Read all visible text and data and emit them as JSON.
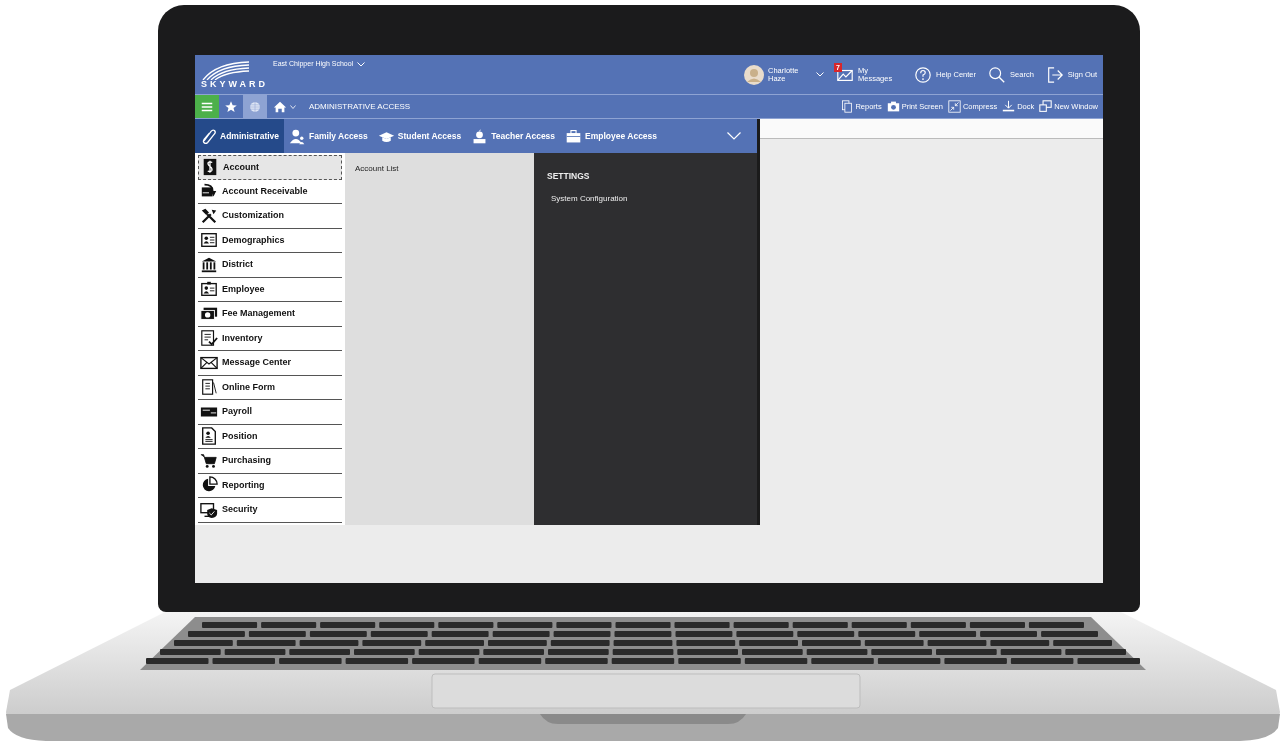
{
  "header": {
    "logo": "SKYWARD",
    "school": "East Chipper High School",
    "user": {
      "name": "Charlotte Haze"
    },
    "actions": [
      {
        "kind": "messages",
        "label": "My Messages",
        "badge": "7"
      },
      {
        "kind": "help",
        "label": "Help Center"
      },
      {
        "kind": "search",
        "label": "Search"
      },
      {
        "kind": "signout",
        "label": "Sign Out"
      }
    ]
  },
  "toolbar": {
    "buttons": [
      {
        "kind": "menu"
      },
      {
        "kind": "star"
      },
      {
        "kind": "globe"
      },
      {
        "kind": "home"
      }
    ],
    "breadcrumb": "ADMINISTRATIVE ACCESS",
    "tools": [
      {
        "kind": "reports",
        "label": "Reports"
      },
      {
        "kind": "print",
        "label": "Print Screen"
      },
      {
        "kind": "compress",
        "label": "Compress"
      },
      {
        "kind": "dock",
        "label": "Dock"
      },
      {
        "kind": "window",
        "label": "New Window"
      }
    ]
  },
  "tabs": [
    {
      "label": "Administrative",
      "selected": true
    },
    {
      "label": "Family Access",
      "selected": false
    },
    {
      "label": "Student Access",
      "selected": false
    },
    {
      "label": "Teacher Access",
      "selected": false
    },
    {
      "label": "Employee Access",
      "selected": false
    }
  ],
  "sidebar": {
    "items": [
      {
        "label": "Account",
        "selected": true
      },
      {
        "label": "Account Receivable",
        "selected": false
      },
      {
        "label": "Customization",
        "selected": false
      },
      {
        "label": "Demographics",
        "selected": false
      },
      {
        "label": "District",
        "selected": false
      },
      {
        "label": "Employee",
        "selected": false
      },
      {
        "label": "Fee Management",
        "selected": false
      },
      {
        "label": "Inventory",
        "selected": false
      },
      {
        "label": "Message Center",
        "selected": false
      },
      {
        "label": "Online Form",
        "selected": false
      },
      {
        "label": "Payroll",
        "selected": false
      },
      {
        "label": "Position",
        "selected": false
      },
      {
        "label": "Purchasing",
        "selected": false
      },
      {
        "label": "Reporting",
        "selected": false
      },
      {
        "label": "Security",
        "selected": false
      }
    ]
  },
  "submenu": {
    "items": [
      "Account List"
    ]
  },
  "settings": {
    "heading": "SETTINGS",
    "items": [
      "System Configuration"
    ]
  }
}
